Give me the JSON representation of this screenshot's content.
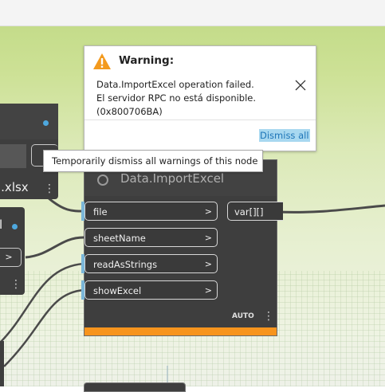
{
  "warning": {
    "title": "Warning:",
    "line1": "Data.ImportExcel operation failed.",
    "line2": "El servidor RPC no está disponible.",
    "line3": "(0x800706BA)",
    "dismiss_all": "Dismiss all",
    "icon": "warning-triangle-icon"
  },
  "tooltip": {
    "text": "Temporarily dismiss all warnings of this node"
  },
  "node": {
    "title": "Data.ImportExcel",
    "inputs": [
      "file",
      "sheetName",
      "readAsStrings",
      "showExcel"
    ],
    "output": "var[][]",
    "lacing": "AUTO",
    "colors": {
      "body": "#3e3e3e",
      "header": "#424242",
      "warning_bar": "#f7941d",
      "port_marker": "#7ab6d8"
    }
  },
  "left_node1": {
    "value_text": "l.xlsx",
    "status_dot_color": "#4ea8de"
  },
  "left_node2": {
    "label": "l",
    "output_chevron": ">",
    "status_dot_color": "#4ea8de"
  }
}
